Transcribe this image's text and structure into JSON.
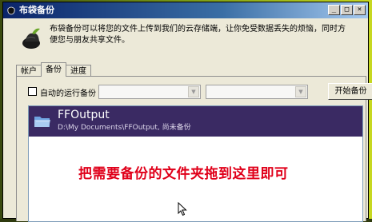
{
  "window": {
    "title": "布袋备份",
    "minimize_glyph": "_",
    "maximize_glyph": "□",
    "close_glyph": "×"
  },
  "description": "布袋备份可以将您的文件上传到我们的云存储端，让你免受数据丢失的烦恼，同时方便您与朋友共享文件。",
  "tabs": [
    {
      "label": "帐户",
      "active": false
    },
    {
      "label": "备份",
      "active": true
    },
    {
      "label": "进度",
      "active": false
    }
  ],
  "backup_options": {
    "autorun_label": "自动的运行备份",
    "autorun_checked": false,
    "combo1_value": "",
    "combo2_value": "",
    "start_button": "开始备份"
  },
  "folders": [
    {
      "name": "FFOutput",
      "path": "D:\\My Documents\\FFOutput, 尚未备份",
      "icon": "folder-icon"
    }
  ],
  "drop_hint": "把需要备份的文件夹拖到这里即可",
  "colors": {
    "accent_titlebar": "#0a246a",
    "selected_row": "#3a2a63",
    "hint_text": "#e0001a"
  }
}
